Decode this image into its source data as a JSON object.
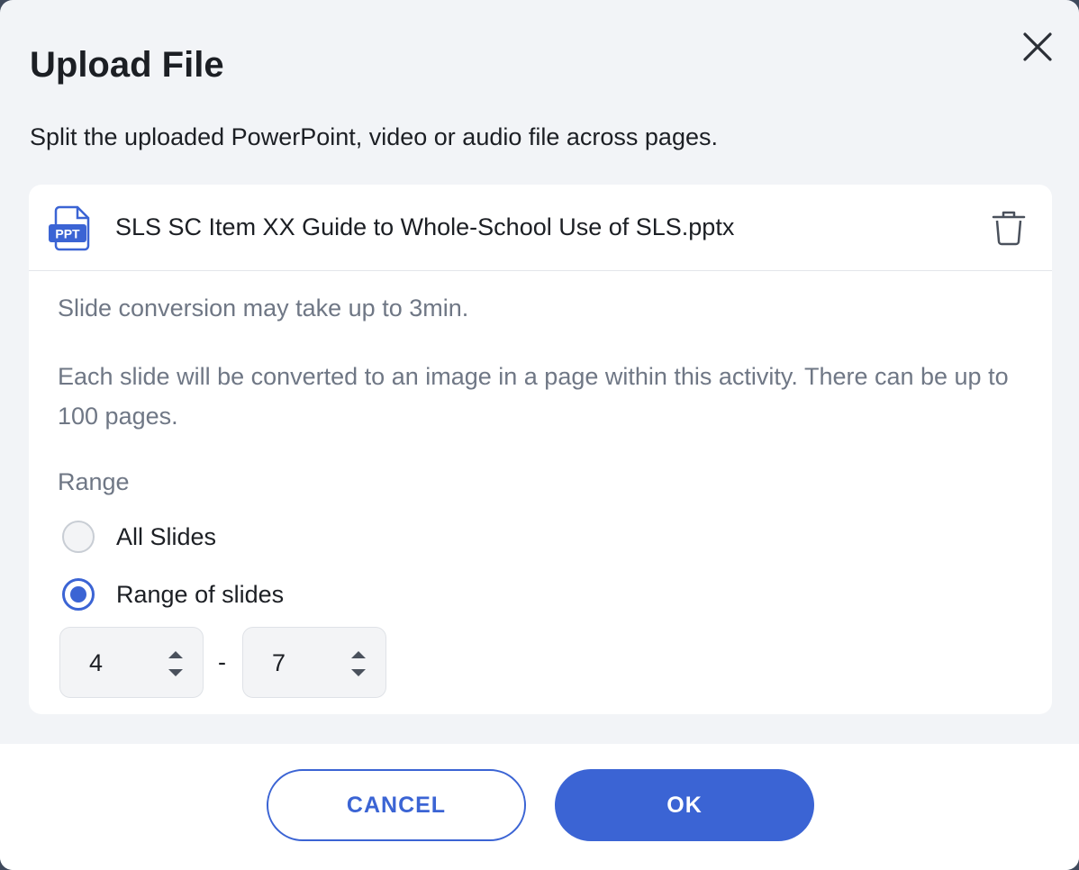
{
  "dialog": {
    "title": "Upload File",
    "subtitle": "Split the uploaded PowerPoint, video or audio file across pages."
  },
  "file": {
    "icon_label": "PPT",
    "name": "SLS SC Item XX Guide to Whole-School Use of SLS.pptx"
  },
  "info": {
    "line1": "Slide conversion may take up to 3min.",
    "line2": "Each slide will be converted to an image in a page within this activity. There can be up to 100 pages."
  },
  "range": {
    "label": "Range",
    "options": [
      {
        "label": "All Slides",
        "checked": false
      },
      {
        "label": "Range of slides",
        "checked": true
      }
    ],
    "from": "4",
    "separator": "-",
    "to": "7"
  },
  "buttons": {
    "cancel": "CANCEL",
    "ok": "OK"
  },
  "colors": {
    "accent": "#3b64d4",
    "muted_text": "#6f7785",
    "dialog_bg": "#f2f4f7"
  },
  "icons": {
    "close": "close-icon",
    "file": "ppt-file-icon",
    "delete": "trash-icon",
    "stepper": "up-down-arrows-icon"
  }
}
